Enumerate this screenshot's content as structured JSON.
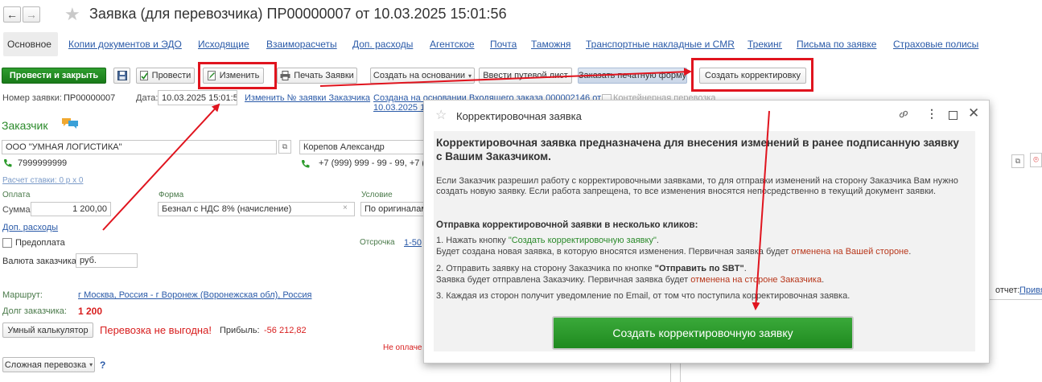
{
  "window": {
    "title": "Заявка (для перевозчика) ПР00000007 от 10.03.2025 15:01:56",
    "back_glyph": "←",
    "forward_glyph": "→",
    "star_glyph": "★"
  },
  "tabs": [
    "Основное",
    "Копии документов и ЭДО",
    "Исходящие",
    "Взаиморасчеты",
    "Доп. расходы",
    "Агентское",
    "Почта",
    "Таможня",
    "Транспортные накладные и CMR",
    "Трекинг",
    "Письма по заявке",
    "Страховые полисы"
  ],
  "toolbar": {
    "post_close": "Провести и закрыть",
    "post": "Провести",
    "edit": "Изменить",
    "print": "Печать Заявки",
    "create_based": "Создать на основании",
    "waybill": "Ввести путевой лист",
    "order_form": "Заказать печатную форму",
    "create_correction": "Создать корректировку"
  },
  "form": {
    "number_label": "Номер заявки:",
    "number_value": "ПР00000007",
    "date_label": "Дата:",
    "date_value": "10.03.2025 15:01:56",
    "change_number_link": "Изменить № заявки Заказчика",
    "based_on_line1": "Создана на основании Входящего заказа 000002146 от",
    "based_on_line2": "10.03.2025 15",
    "container_check": "Контейнерная перевозка",
    "customer_heading": "Заказчик",
    "customer_value": "ООО \"УМНАЯ ЛОГИСТИКА\"",
    "contact_value": "Корепов Александр",
    "customer_phone": "7999999999",
    "contact_phone": "+7 (999) 999 - 99 - 99, +7 (99",
    "rate_calc": "Расчет ставки: 0 р x 0",
    "payment_label": "Оплата",
    "sum_label": "Сумма:",
    "sum_value": "1 200,00",
    "form_label": "Форма",
    "form_value": "Безнал с НДС 8% (начисление)",
    "condition_label": "Условие",
    "condition_value": "По оригиналам",
    "extra_costs": "Доп. расходы",
    "prepay": "Предоплата",
    "deferral_label": "Отсрочка",
    "deferral_value": "1-50",
    "currency_label": "Валюта заказчика:",
    "currency_value": "руб.",
    "route_label": "Маршрут:",
    "route_value": "г Москва, Россия - г Воронеж (Воронежская обл), Россия",
    "debt_label": "Долг заказчика:",
    "debt_value": "1 200",
    "calc_button": "Умный калькулятор",
    "unprofitable": "Перевозка не выгодна!",
    "profit_label": "Прибыль:",
    "profit_value": "-56 212,82",
    "not_paid": "Не оплаче",
    "complex_button": "Сложная перевозка",
    "help": "?",
    "report_label": "отчет:",
    "report_link": "Привя"
  },
  "dialog": {
    "title": "Корректировочная заявка",
    "heading": "Корректировочная заявка предназначена для внесения изменений в ранее подписанную заявку с Вашим Заказчиком.",
    "intro": "Если Заказчик разрешил работу с корректировочными заявками, то для отправки изменений на сторону Заказчика Вам нужно создать новую заявку. Если работа запрещена, то все изменения вносятся непосредственно в текущий документ заявки.",
    "subheading": "Отправка корректировочной заявки в несколько кликов:",
    "step1_a": "1. Нажать кнопку ",
    "step1_link": "\"Создать корректировочную заявку\"",
    "step1_b": ".",
    "step1_c": "Будет создана новая заявка, в которую вносятся изменения. Первичная заявка будет ",
    "step1_red": "отменена на Вашей стороне",
    "step1_d": ".",
    "step2_a": "2. Отправить заявку на сторону Заказчика по кнопке ",
    "step2_bold": "\"Отправить по SBT\"",
    "step2_b": ".",
    "step2_c": "Заявка будет отправлена Заказчику. Первичная заявка будет ",
    "step2_red": "отменена на стороне Заказчика",
    "step2_d": ".",
    "step3": "3. Каждая из сторон получит уведомление по Email, от том что поступила корректировочная заявка.",
    "create_button": "Создать корректировочную заявку"
  },
  "colors": {
    "accent_green": "#1f8a1f",
    "annotation_red": "#e0141e",
    "link_blue": "#2a5aa8",
    "error_red": "#d81e1e"
  }
}
